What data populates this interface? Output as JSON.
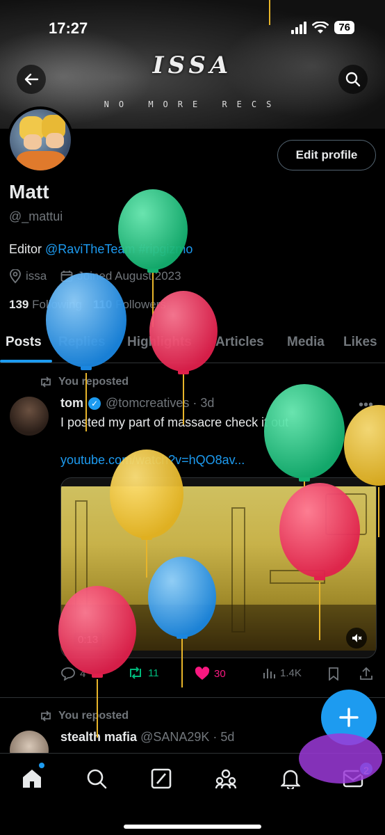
{
  "status_bar": {
    "time": "17:27",
    "battery": "76"
  },
  "banner": {
    "logo": "ISSA",
    "subtitle": "NO MORE RECS"
  },
  "profile": {
    "name": "Matt",
    "handle": "@_mattui",
    "bio_prefix": "Editor ",
    "bio_mention": "@RaviTheTeam",
    "bio_hashtag": "#ripgizmo",
    "location": "issa",
    "joined": "Joined August 2023",
    "following_count": "139",
    "following_label": "Following",
    "followers_count": "110",
    "followers_label": "Followers",
    "edit_button": "Edit profile"
  },
  "tabs": [
    "Posts",
    "Replies",
    "Highlights",
    "Articles",
    "Media",
    "Likes"
  ],
  "posts": [
    {
      "repost_label": "You reposted",
      "author": "tom",
      "handle": "@tomcreatives",
      "time": "3d",
      "text": "I posted my part of massacre check it out",
      "link": "youtube.com/watch?v=hQO8av...",
      "video_time": "0:13",
      "replies": "4",
      "reposts": "11",
      "likes": "30",
      "views": "1.4K"
    },
    {
      "repost_label": "You reposted",
      "author": "stealth mafia",
      "handle": "@SANA29K",
      "time": "5d"
    }
  ],
  "nav": {
    "messages_badge": "2"
  },
  "colors": {
    "accent": "#1d9bf0",
    "like": "#f91880",
    "repost": "#00ba7c"
  }
}
